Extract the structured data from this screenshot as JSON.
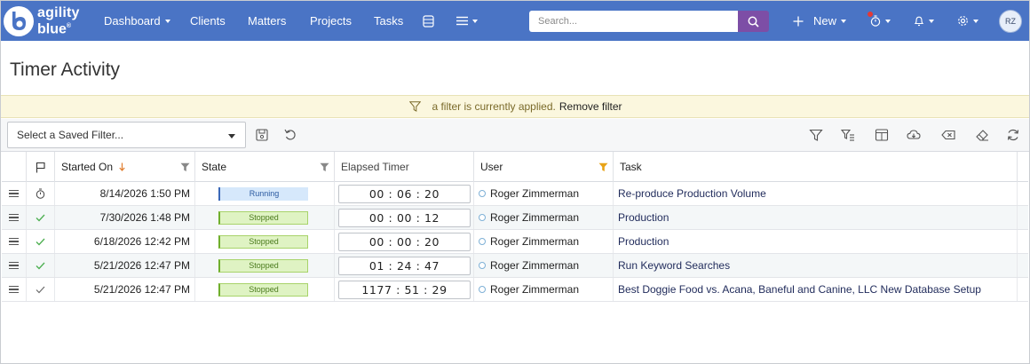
{
  "brand": {
    "line1": "agility",
    "line2": "blue",
    "mark": "®"
  },
  "nav": {
    "dashboard": "Dashboard",
    "clients": "Clients",
    "matters": "Matters",
    "projects": "Projects",
    "tasks": "Tasks",
    "search_placeholder": "Search...",
    "new_label": "New",
    "user_initials": "RZ"
  },
  "page": {
    "title": "Timer Activity",
    "filter_notice": "a filter is currently applied.",
    "remove_filter": "Remove filter",
    "saved_filter_placeholder": "Select a Saved Filter..."
  },
  "columns": {
    "started_on": "Started On",
    "state": "State",
    "elapsed": "Elapsed Timer",
    "user": "User",
    "task": "Task"
  },
  "rows": [
    {
      "started": "8/14/2026 1:50 PM",
      "state": "Running",
      "elapsed": "00 : 06 : 20",
      "user": "Roger Zimmerman",
      "task": "Re-produce Production Volume"
    },
    {
      "started": "7/30/2026 1:48 PM",
      "state": "Stopped",
      "elapsed": "00 : 00 : 12",
      "user": "Roger Zimmerman",
      "task": "Production"
    },
    {
      "started": "6/18/2026 12:42 PM",
      "state": "Stopped",
      "elapsed": "00 : 00 : 20",
      "user": "Roger Zimmerman",
      "task": "Production"
    },
    {
      "started": "5/21/2026 12:47 PM",
      "state": "Stopped",
      "elapsed": "01 : 24 : 47",
      "user": "Roger Zimmerman",
      "task": "Run Keyword Searches"
    },
    {
      "started": "5/21/2026 12:47 PM",
      "state": "Stopped",
      "elapsed": "1177 : 51 : 29",
      "user": "Roger Zimmerman",
      "task": "Best Doggie Food vs. Acana, Baneful and Canine, LLC New Database Setup"
    }
  ],
  "colors": {
    "navbar": "#4a74c5",
    "search_button": "#7d4ea6",
    "running": "#d6e8fb",
    "stopped": "#dff3c3",
    "filter_bar": "#fbf7de",
    "active_filter_icon": "#e8a317",
    "sort_arrow": "#e07b2a"
  },
  "icons": {
    "navbar": [
      "logo-mark",
      "chevron-down-icon",
      "database-icon",
      "hamburger-menu-icon",
      "search-icon",
      "plus-icon",
      "stopwatch-icon",
      "bell-icon",
      "gear-icon"
    ],
    "toolbar": [
      "save-icon",
      "undo-icon",
      "filter-icon",
      "filter-list-icon",
      "columns-icon",
      "download-cloud-icon",
      "clear-input-icon",
      "eraser-icon",
      "refresh-icon"
    ],
    "grid": [
      "flag-icon",
      "sort-down-arrow-icon",
      "column-filter-icon",
      "drag-handle-icon",
      "stopwatch-icon",
      "checkmark-icon",
      "status-dot-icon"
    ]
  }
}
